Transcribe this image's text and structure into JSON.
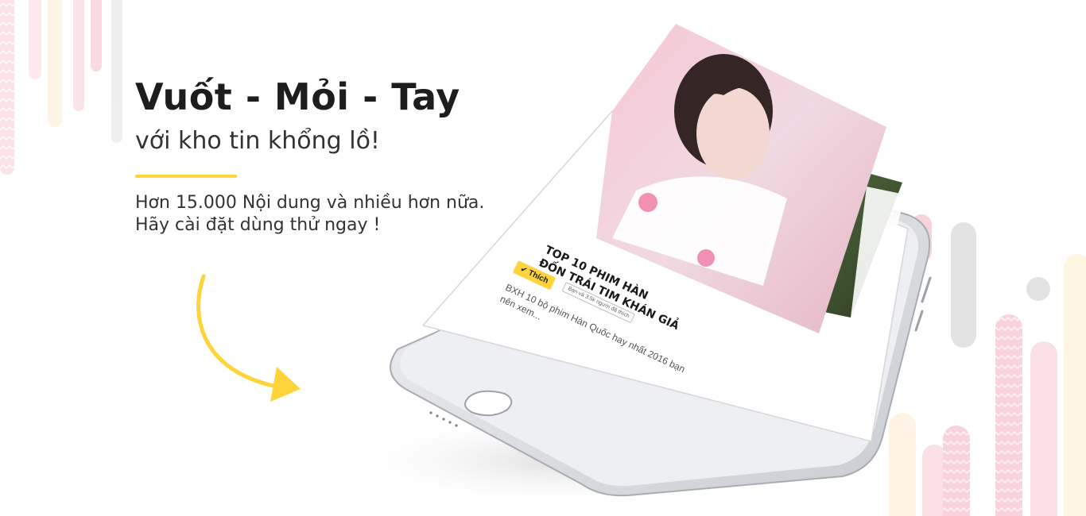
{
  "hero": {
    "headline": "Vuốt - Mỏi - Tay",
    "subline": "với kho tin khổng lồ!",
    "description_line1": "Hơn 15.000 Nội dung và nhiều hơn nữa.",
    "description_line2": "Hãy cài đặt dùng thử ngay !"
  },
  "phone_card": {
    "title_line1": "TOP 10 PHIM HÀN",
    "title_line2": "ĐỐN TRÁI TIM KHÁN GIẢ",
    "like_label": "Thích",
    "like_count": "Bạn và 3.5k người đã thích",
    "excerpt": "BXH 10 bộ phim Hàn Quốc hay nhất 2016 bạn nên xem..."
  },
  "colors": {
    "accent_yellow": "#ffd43b",
    "headline": "#1d1d1d",
    "decor_pink": "#f9d3dc",
    "decor_grey": "#e3e3e3"
  },
  "icons": [
    "curved-arrow-icon",
    "check-icon",
    "home-button-icon"
  ]
}
